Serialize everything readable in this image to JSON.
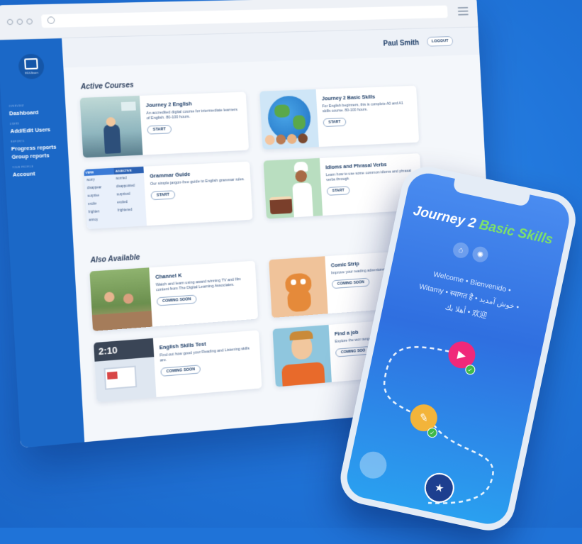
{
  "browser": {
    "user_name": "Paul Smith",
    "logout_label": "LOGOUT",
    "logo_text": "EDUlearn"
  },
  "sidebar": {
    "items": [
      {
        "section": "overview",
        "label": "Dashboard"
      },
      {
        "section": "users",
        "label": "Add/Edit Users"
      },
      {
        "section": "reports",
        "label": "Progress reports"
      },
      {
        "section": "",
        "label": "Group reports"
      },
      {
        "section": "your profile",
        "label": "Account"
      }
    ]
  },
  "active": {
    "title": "Active Courses",
    "courses": [
      {
        "title": "Journey 2 English",
        "desc": "An accredited digital course for intermediate learners of English. 80-100 hours.",
        "button": "START"
      },
      {
        "title": "Journey 2 Basic Skills",
        "desc": "For English beginners, this is complete A0 and A1 skills course. 80-100 hours.",
        "button": "START"
      },
      {
        "title": "Grammar Guide",
        "desc": "Our simple jargon-free guide to English grammar rules.",
        "button": "START"
      },
      {
        "title": "Idioms and Phrasal Verbs",
        "desc": "Learn how to use some common idioms and phrasal verbs through",
        "button": "START"
      }
    ]
  },
  "also": {
    "title": "Also Available",
    "items": [
      {
        "title": "Channel K",
        "desc": "Watch and learn using award winning TV and film content from The Digital Learning Associates.",
        "button": "COMING SOON"
      },
      {
        "title": "Comic Strip",
        "desc": "Improve your reading adventures of Stan, P",
        "button": "COMING SOON"
      },
      {
        "title": "English Skills Test",
        "desc": "Find out how good your Reading and Listening skills are.",
        "button": "COMING SOON"
      },
      {
        "title": "Find a job",
        "desc": "Explore the wor range of differe",
        "button": "COMING SOO"
      }
    ]
  },
  "grammar_table": {
    "headers": [
      "VERB",
      "ADJECTIVE"
    ],
    "rows": [
      [
        "worry",
        "worried"
      ],
      [
        "disappear",
        "disappointed"
      ],
      [
        "surprise",
        "surprised"
      ],
      [
        "excite",
        "excited"
      ],
      [
        "frighten",
        "frightened"
      ],
      [
        "annoy",
        ""
      ]
    ]
  },
  "phone": {
    "title_part1": "Journey 2 ",
    "title_part2": "Basic Skills",
    "greet_line1": "Welcome • Bienvenido •",
    "greet_line2": "Witamy • स्वागत है • خوش آمدید •",
    "greet_line3": "أهلا بك • 欢迎",
    "time_label": "2:10"
  },
  "colors": {
    "background": "#1f73d8",
    "sidebar": "#1b68c7",
    "phone_accent": "#7ee06a",
    "node_video": "#f0287a",
    "node_task": "#f3b43a",
    "check": "#3fb94a"
  },
  "icons": [
    "home-icon",
    "brain-icon",
    "video-camera-icon",
    "clipboard-icon",
    "australia-flag-icon",
    "check-icon"
  ]
}
